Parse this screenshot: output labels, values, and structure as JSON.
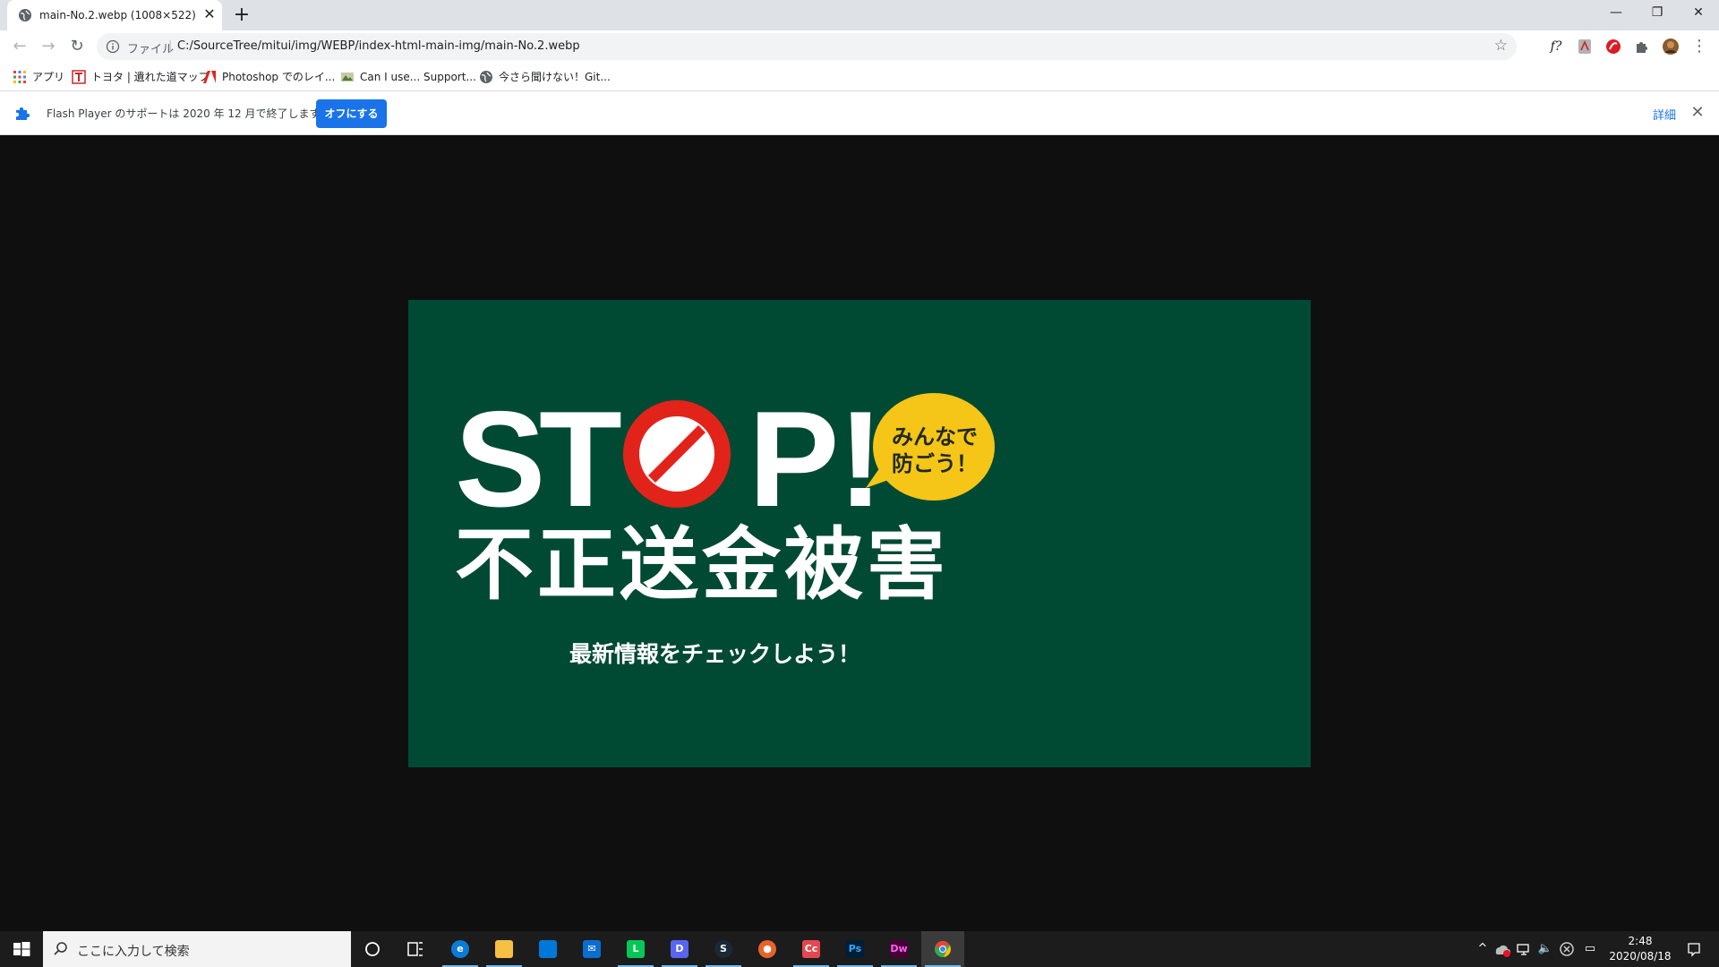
{
  "browser": {
    "tab": {
      "title": "main-No.2.webp (1008×522)",
      "close": "✕"
    },
    "new_tab": "+",
    "window_controls": {
      "minimize": "—",
      "restore": "❐",
      "close": "✕"
    },
    "nav": {
      "back": "←",
      "forward": "→",
      "reload": "↻"
    },
    "omnibox": {
      "scheme_label": "ファイル",
      "separator": "|",
      "url": "C:/SourceTree/mitui/img/WEBP/index-html-main-img/main-No.2.webp",
      "star": "☆"
    },
    "toolbar_icons": {
      "font_ext": "f?",
      "menu": "⋮"
    }
  },
  "bookmarks": [
    {
      "label": "アプリ",
      "icon": "apps-grid-icon"
    },
    {
      "label": "トヨタ | 遺れた道マップ",
      "icon": "toyota-t-icon"
    },
    {
      "label": "Photoshop でのレイ...",
      "icon": "adobe-icon"
    },
    {
      "label": "Can I use... Support...",
      "icon": "caniuse-icon"
    },
    {
      "label": "今さら聞けない！Git...",
      "icon": "globe-icon"
    }
  ],
  "infobar": {
    "message": "Flash Player のサポートは 2020 年 12 月で終了します。",
    "button": "オフにする",
    "details": "詳細",
    "close": "✕"
  },
  "banner": {
    "stop_s": "S",
    "stop_t": "T",
    "stop_p": "P",
    "stop_ex": "!",
    "bubble_line1": "みんなで",
    "bubble_line2": "防ごう！",
    "main": "不正送金被害",
    "sub": "最新情報をチェックしよう！",
    "colors": {
      "background": "#004a33",
      "no_sign": "#e2231a",
      "bubble": "#f5c518"
    }
  },
  "taskbar": {
    "search_placeholder": "ここに入力して検索",
    "apps": [
      {
        "name": "edge",
        "label": "e",
        "color": "#0c7bd6"
      },
      {
        "name": "explorer",
        "label": "",
        "color": "#f5c043"
      },
      {
        "name": "store",
        "label": "",
        "color": "#0078d7"
      },
      {
        "name": "mail",
        "label": "✉",
        "color": "#0a6ed1"
      },
      {
        "name": "line",
        "label": "L",
        "color": "#06c755"
      },
      {
        "name": "discord",
        "label": "D",
        "color": "#5865f2"
      },
      {
        "name": "steam",
        "label": "S",
        "color": "#1b2838"
      },
      {
        "name": "maps",
        "label": "●",
        "color": "#e8632b"
      },
      {
        "name": "creative-cloud",
        "label": "Cc",
        "color": "#e34850"
      },
      {
        "name": "photoshop",
        "label": "Ps",
        "color": "#001e36"
      },
      {
        "name": "dreamweaver",
        "label": "Dw",
        "color": "#470137"
      },
      {
        "name": "chrome",
        "label": "",
        "color": "#dd4b39"
      }
    ],
    "tray": {
      "chevron": "^",
      "volume": "🔈",
      "notifications": "▭"
    },
    "clock": {
      "time": "2:48",
      "date": "2020/08/18"
    }
  }
}
